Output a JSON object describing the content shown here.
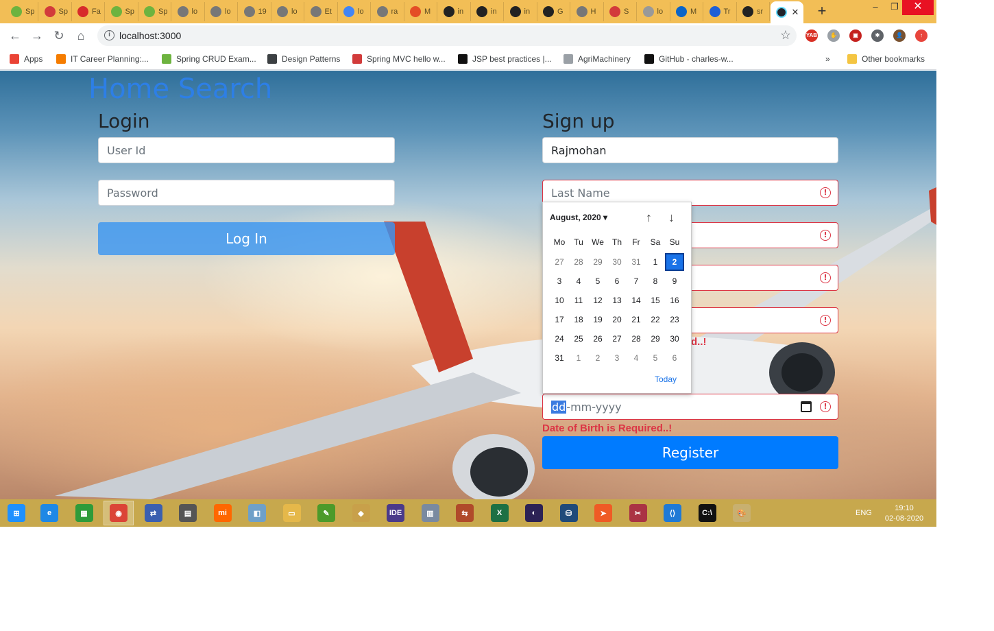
{
  "browser": {
    "tabs": [
      {
        "label": "Sp",
        "color": "#6db33f"
      },
      {
        "label": "Sp",
        "color": "#d23b3b"
      },
      {
        "label": "Fa",
        "color": "#d72b2b"
      },
      {
        "label": "Sp",
        "color": "#6db33f"
      },
      {
        "label": "Sp",
        "color": "#6db33f"
      },
      {
        "label": "lo",
        "color": "#777777"
      },
      {
        "label": "lo",
        "color": "#777777"
      },
      {
        "label": "19",
        "color": "#777777"
      },
      {
        "label": "lo",
        "color": "#777777"
      },
      {
        "label": "Et",
        "color": "#777777"
      },
      {
        "label": "lo",
        "color": "#4285f4"
      },
      {
        "label": "ra",
        "color": "#777777"
      },
      {
        "label": "M",
        "color": "#e44d26"
      },
      {
        "label": "in",
        "color": "#222222"
      },
      {
        "label": "in",
        "color": "#222222"
      },
      {
        "label": "in",
        "color": "#222222"
      },
      {
        "label": "G",
        "color": "#222222"
      },
      {
        "label": "H",
        "color": "#777777"
      },
      {
        "label": "S",
        "color": "#d23b3b"
      },
      {
        "label": "lo",
        "color": "#999999"
      },
      {
        "label": "M",
        "color": "#0a64c8"
      },
      {
        "label": "Tr",
        "color": "#1f5fd6"
      },
      {
        "label": "sr",
        "color": "#222222"
      }
    ],
    "active_tab_color": "#61dafb",
    "close_tab_glyph": "✕",
    "new_tab_glyph": "+",
    "window_controls": {
      "minimize": "–",
      "restore": "❐",
      "close": "✕"
    },
    "nav": {
      "back": "←",
      "forward": "→",
      "reload": "↻",
      "home": "⌂"
    },
    "url": "localhost:3000",
    "info_glyph": "i",
    "star_glyph": "☆",
    "extensions": [
      {
        "label": "YAB",
        "color": "#d93025"
      },
      {
        "label": "✋",
        "color": "#9aa0a6"
      },
      {
        "label": "▣",
        "color": "#c5221f"
      },
      {
        "label": "✱",
        "color": "#5f6368"
      },
      {
        "label": "👤",
        "color": "#7a5230"
      },
      {
        "label": "↑",
        "color": "#e8453c"
      }
    ],
    "bookmarks": [
      {
        "label": "Apps",
        "color": "#ea4335"
      },
      {
        "label": "IT Career Planning:...",
        "color": "#f57c00"
      },
      {
        "label": "Spring CRUD Exam...",
        "color": "#6db33f"
      },
      {
        "label": "Design Patterns",
        "color": "#3c4043"
      },
      {
        "label": "Spring MVC hello w...",
        "color": "#d23b3b"
      },
      {
        "label": "JSP best practices |...",
        "color": "#111111"
      },
      {
        "label": "AgriMachinery",
        "color": "#9aa0a6"
      },
      {
        "label": "GitHub - charles-w...",
        "color": "#111111"
      }
    ],
    "more_glyph": "»",
    "other_bookmarks": "Other bookmarks"
  },
  "page": {
    "title": "Home Search",
    "login": {
      "heading": "Login",
      "user_id_placeholder": "User Id",
      "password_placeholder": "Password",
      "button": "Log In"
    },
    "signup": {
      "heading": "Sign up",
      "first_name_value": "Rajmohan",
      "last_name_placeholder": "Last Name",
      "error_glyph": "!",
      "hidden_error_fragment": "d..!",
      "dob": {
        "dd": "dd",
        "rest": "-mm-yyyy"
      },
      "dob_error": "Date of Birth is Required..!",
      "button": "Register"
    },
    "calendar": {
      "month_label": "August, 2020 ▾",
      "up_glyph": "↑",
      "down_glyph": "↓",
      "weekdays": [
        "Mo",
        "Tu",
        "We",
        "Th",
        "Fr",
        "Sa",
        "Su"
      ],
      "weeks": [
        [
          {
            "d": "27",
            "other": true
          },
          {
            "d": "28",
            "other": true
          },
          {
            "d": "29",
            "other": true
          },
          {
            "d": "30",
            "other": true
          },
          {
            "d": "31",
            "other": true
          },
          {
            "d": "1"
          },
          {
            "d": "2",
            "selected": true
          }
        ],
        [
          {
            "d": "3"
          },
          {
            "d": "4"
          },
          {
            "d": "5"
          },
          {
            "d": "6"
          },
          {
            "d": "7"
          },
          {
            "d": "8"
          },
          {
            "d": "9"
          }
        ],
        [
          {
            "d": "10"
          },
          {
            "d": "11"
          },
          {
            "d": "12"
          },
          {
            "d": "13"
          },
          {
            "d": "14"
          },
          {
            "d": "15"
          },
          {
            "d": "16"
          }
        ],
        [
          {
            "d": "17"
          },
          {
            "d": "18"
          },
          {
            "d": "19"
          },
          {
            "d": "20"
          },
          {
            "d": "21"
          },
          {
            "d": "22"
          },
          {
            "d": "23"
          }
        ],
        [
          {
            "d": "24"
          },
          {
            "d": "25"
          },
          {
            "d": "26"
          },
          {
            "d": "27"
          },
          {
            "d": "28"
          },
          {
            "d": "29"
          },
          {
            "d": "30"
          }
        ],
        [
          {
            "d": "31"
          },
          {
            "d": "1",
            "other": true
          },
          {
            "d": "2",
            "other": true
          },
          {
            "d": "3",
            "other": true
          },
          {
            "d": "4",
            "other": true
          },
          {
            "d": "5",
            "other": true
          },
          {
            "d": "6",
            "other": true
          }
        ]
      ],
      "today_label": "Today"
    }
  },
  "taskbar": {
    "apps": [
      {
        "name": "start-icon",
        "glyph": "⊞",
        "color": "#1e90ff"
      },
      {
        "name": "internet-explorer-icon",
        "glyph": "e",
        "color": "#1e88e5"
      },
      {
        "name": "store-icon",
        "glyph": "▦",
        "color": "#2e9b3a"
      },
      {
        "name": "chrome-icon",
        "glyph": "◉",
        "color": "#db4437"
      },
      {
        "name": "network-icon",
        "glyph": "⇄",
        "color": "#3b5fb0"
      },
      {
        "name": "devices-icon",
        "glyph": "▤",
        "color": "#555555"
      },
      {
        "name": "mi-icon",
        "glyph": "mi",
        "color": "#ff6700"
      },
      {
        "name": "notebook-icon",
        "glyph": "◧",
        "color": "#6fa0c8"
      },
      {
        "name": "file-explorer-icon",
        "glyph": "▭",
        "color": "#e5b84a"
      },
      {
        "name": "notepad-plus-icon",
        "glyph": "✎",
        "color": "#4c9a2a"
      },
      {
        "name": "git-icon",
        "glyph": "◆",
        "color": "#c8a04a"
      },
      {
        "name": "javaee-ide-icon",
        "glyph": "IDE",
        "color": "#4a3a8a"
      },
      {
        "name": "monitor-icon",
        "glyph": "▥",
        "color": "#7a8aa0"
      },
      {
        "name": "filezilla-icon",
        "glyph": "⇆",
        "color": "#b04a2a"
      },
      {
        "name": "excel-icon",
        "glyph": "X",
        "color": "#1d7044"
      },
      {
        "name": "eclipse-icon",
        "glyph": "◐",
        "color": "#2c2255"
      },
      {
        "name": "mysql-icon",
        "glyph": "⛁",
        "color": "#1f4a7a"
      },
      {
        "name": "postman-icon",
        "glyph": "➤",
        "color": "#ef5b25"
      },
      {
        "name": "snipping-tool-icon",
        "glyph": "✂",
        "color": "#aa3344"
      },
      {
        "name": "vscode-icon",
        "glyph": "⟨⟩",
        "color": "#1f7ad6"
      },
      {
        "name": "cmd-icon",
        "glyph": "C:\\",
        "color": "#111111"
      },
      {
        "name": "paint-icon",
        "glyph": "🎨",
        "color": "#c8b070"
      }
    ],
    "lang": "ENG",
    "time": "19:10",
    "date": "02-08-2020"
  }
}
